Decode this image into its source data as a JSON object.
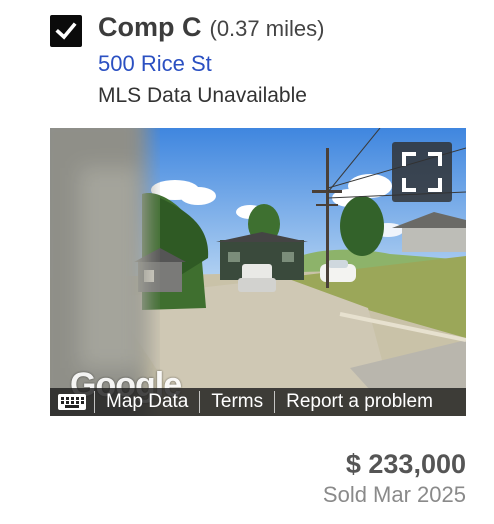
{
  "comp": {
    "selected": true,
    "name": "Comp C",
    "distance": "(0.37 miles)",
    "address": "500 Rice St",
    "mls_status": "MLS Data Unavailable"
  },
  "street_view": {
    "logo": "Google",
    "keyboard_icon": "keyboard-icon",
    "fullscreen_icon": "fullscreen-icon",
    "links": {
      "map_data": "Map Data",
      "terms": "Terms",
      "report": "Report a problem"
    }
  },
  "sale": {
    "price": "$ 233,000",
    "sold_date": "Sold Mar 2025"
  },
  "colors": {
    "link": "#2b50c2",
    "checkbox": "#0b0b0b",
    "price": "#555555",
    "muted": "#8a8a8a"
  }
}
